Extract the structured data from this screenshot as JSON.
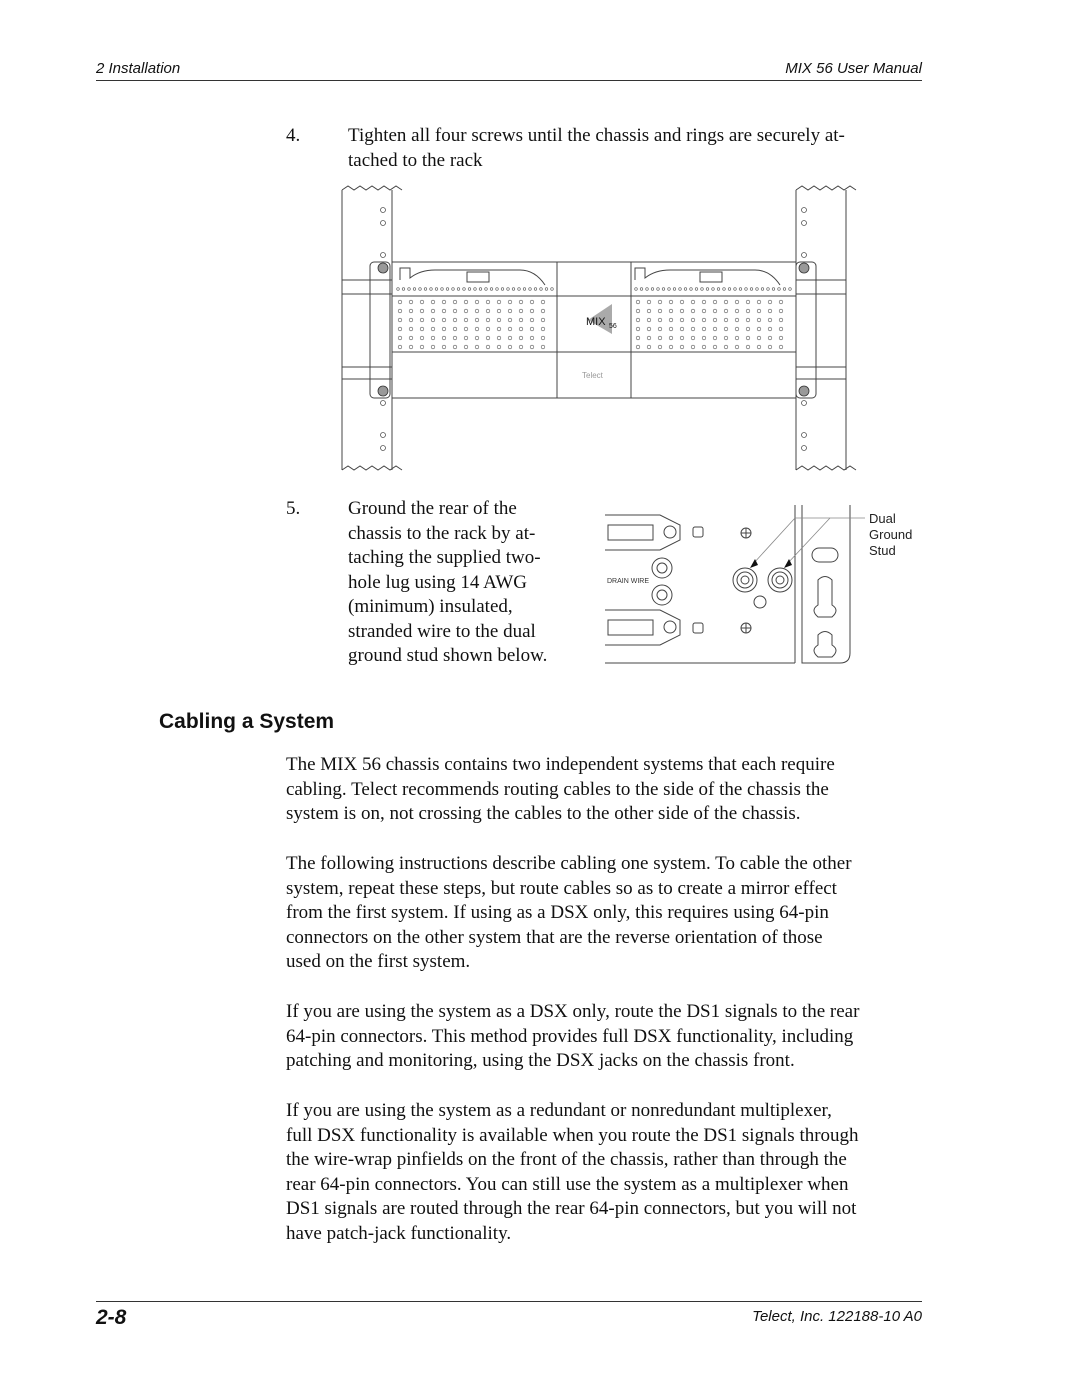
{
  "header": {
    "section": "2  Installation",
    "title": "MIX 56 User Manual"
  },
  "steps": [
    {
      "number": "4.",
      "text": "Tighten all four screws until the chassis and rings are securely at-tached to the rack",
      "lines": [
        "Tighten all four screws until the chassis and rings are securely at-",
        "tached to the rack"
      ]
    },
    {
      "number": "5.",
      "text": "Ground the rear of the chassis to the rack by at-taching the supplied two-hole lug using 14 AWG (minimum) insulated, stranded wire to the dual ground stud shown below.",
      "lines": [
        "Ground the rear of the",
        "chassis to the rack by at-",
        "taching the supplied two-",
        "hole lug using 14 AWG",
        "(minimum) insulated,",
        "stranded wire to the dual",
        "ground stud shown below."
      ]
    }
  ],
  "figure_front": {
    "logo": "MIX",
    "logo_sub": "56",
    "brand": "Telect"
  },
  "figure_rear": {
    "drain_label": "DRAIN WIRE",
    "callout": [
      "Dual",
      "Ground",
      "Stud"
    ]
  },
  "section": {
    "title": "Cabling a System"
  },
  "paragraphs": [
    [
      "The MIX 56 chassis contains two independent systems that each require",
      "cabling. Telect recommends routing cables to the side of the chassis the",
      "system is on, not crossing the cables to the other side of the chassis."
    ],
    [
      "The following instructions describe cabling one system. To cable the other",
      "system, repeat these steps, but route cables so as to create a mirror effect",
      "from the first system. If using as a DSX only, this requires using 64-pin",
      "connectors on the other system that are the reverse orientation of those",
      "used on the first system."
    ],
    [
      "If you are using the system as a DSX only, route the DS1 signals to the rear",
      "64-pin connectors. This method provides full DSX functionality, including",
      "patching and monitoring, using the DSX jacks on the chassis front."
    ],
    [
      "If you are using the system as a redundant or nonredundant multiplexer,",
      "full DSX functionality is available when you route the DS1 signals through",
      "the wire-wrap pinfields on the front of the chassis, rather than through the",
      "rear 64-pin connectors. You can still use the system as a multiplexer when",
      "DS1 signals are routed through the rear 64-pin connectors, but you will not",
      "have patch-jack functionality."
    ]
  ],
  "footer": {
    "page": "2-8",
    "doc": "Telect, Inc.  122188-10 A0"
  }
}
